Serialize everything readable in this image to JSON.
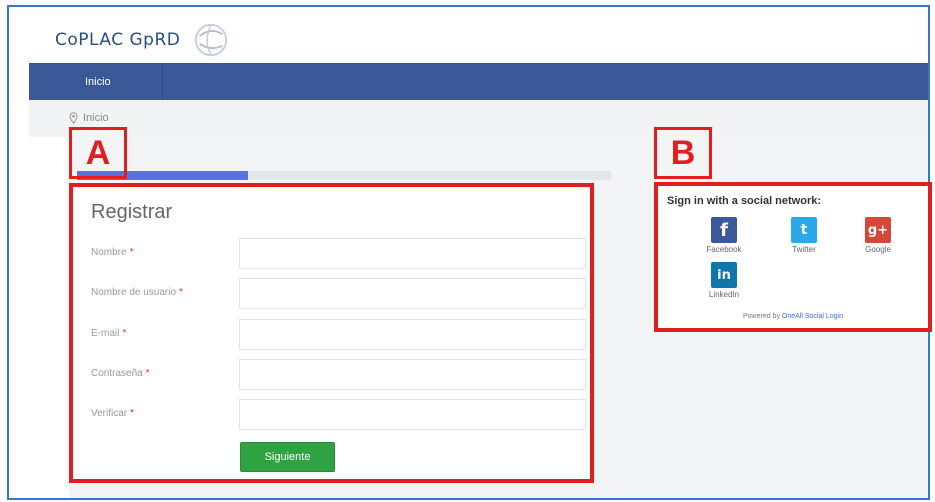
{
  "header": {
    "brand": "CoPLAC GpRD",
    "logo_icon": "globe-logo-icon"
  },
  "nav": {
    "items": [
      {
        "label": "Inicio"
      }
    ]
  },
  "breadcrumb": {
    "icon": "map-pin-icon",
    "label": "Inicio"
  },
  "progress": {
    "value": 0.32
  },
  "annotations": {
    "a": "A",
    "b": "B"
  },
  "register_form": {
    "title": "Registrar",
    "required_mark": "*",
    "fields": [
      {
        "label": "Nombre",
        "value": "",
        "placeholder": ""
      },
      {
        "label": "Nombre de usuario",
        "value": "",
        "placeholder": ""
      },
      {
        "label": "E-mail",
        "value": "",
        "placeholder": ""
      },
      {
        "label": "Contraseña",
        "value": "",
        "placeholder": ""
      },
      {
        "label": "Verificar",
        "value": "",
        "placeholder": ""
      }
    ],
    "submit_label": "Siguiente"
  },
  "social_login": {
    "title": "Sign in with a social network:",
    "providers": [
      {
        "label": "Facebook",
        "icon": "facebook-icon",
        "glyph": "f"
      },
      {
        "label": "Twitter",
        "icon": "twitter-icon",
        "glyph": "t"
      },
      {
        "label": "Google",
        "icon": "google-plus-icon",
        "glyph": "g+"
      },
      {
        "label": "LinkedIn",
        "icon": "linkedin-icon",
        "glyph": "in"
      }
    ],
    "powered_prefix": "Powered by ",
    "powered_link": "OneAll Social Login"
  },
  "colors": {
    "navbar": "#3b5998",
    "highlight": "#e02020",
    "button": "#2fa341",
    "progress": "#5b73e0"
  }
}
